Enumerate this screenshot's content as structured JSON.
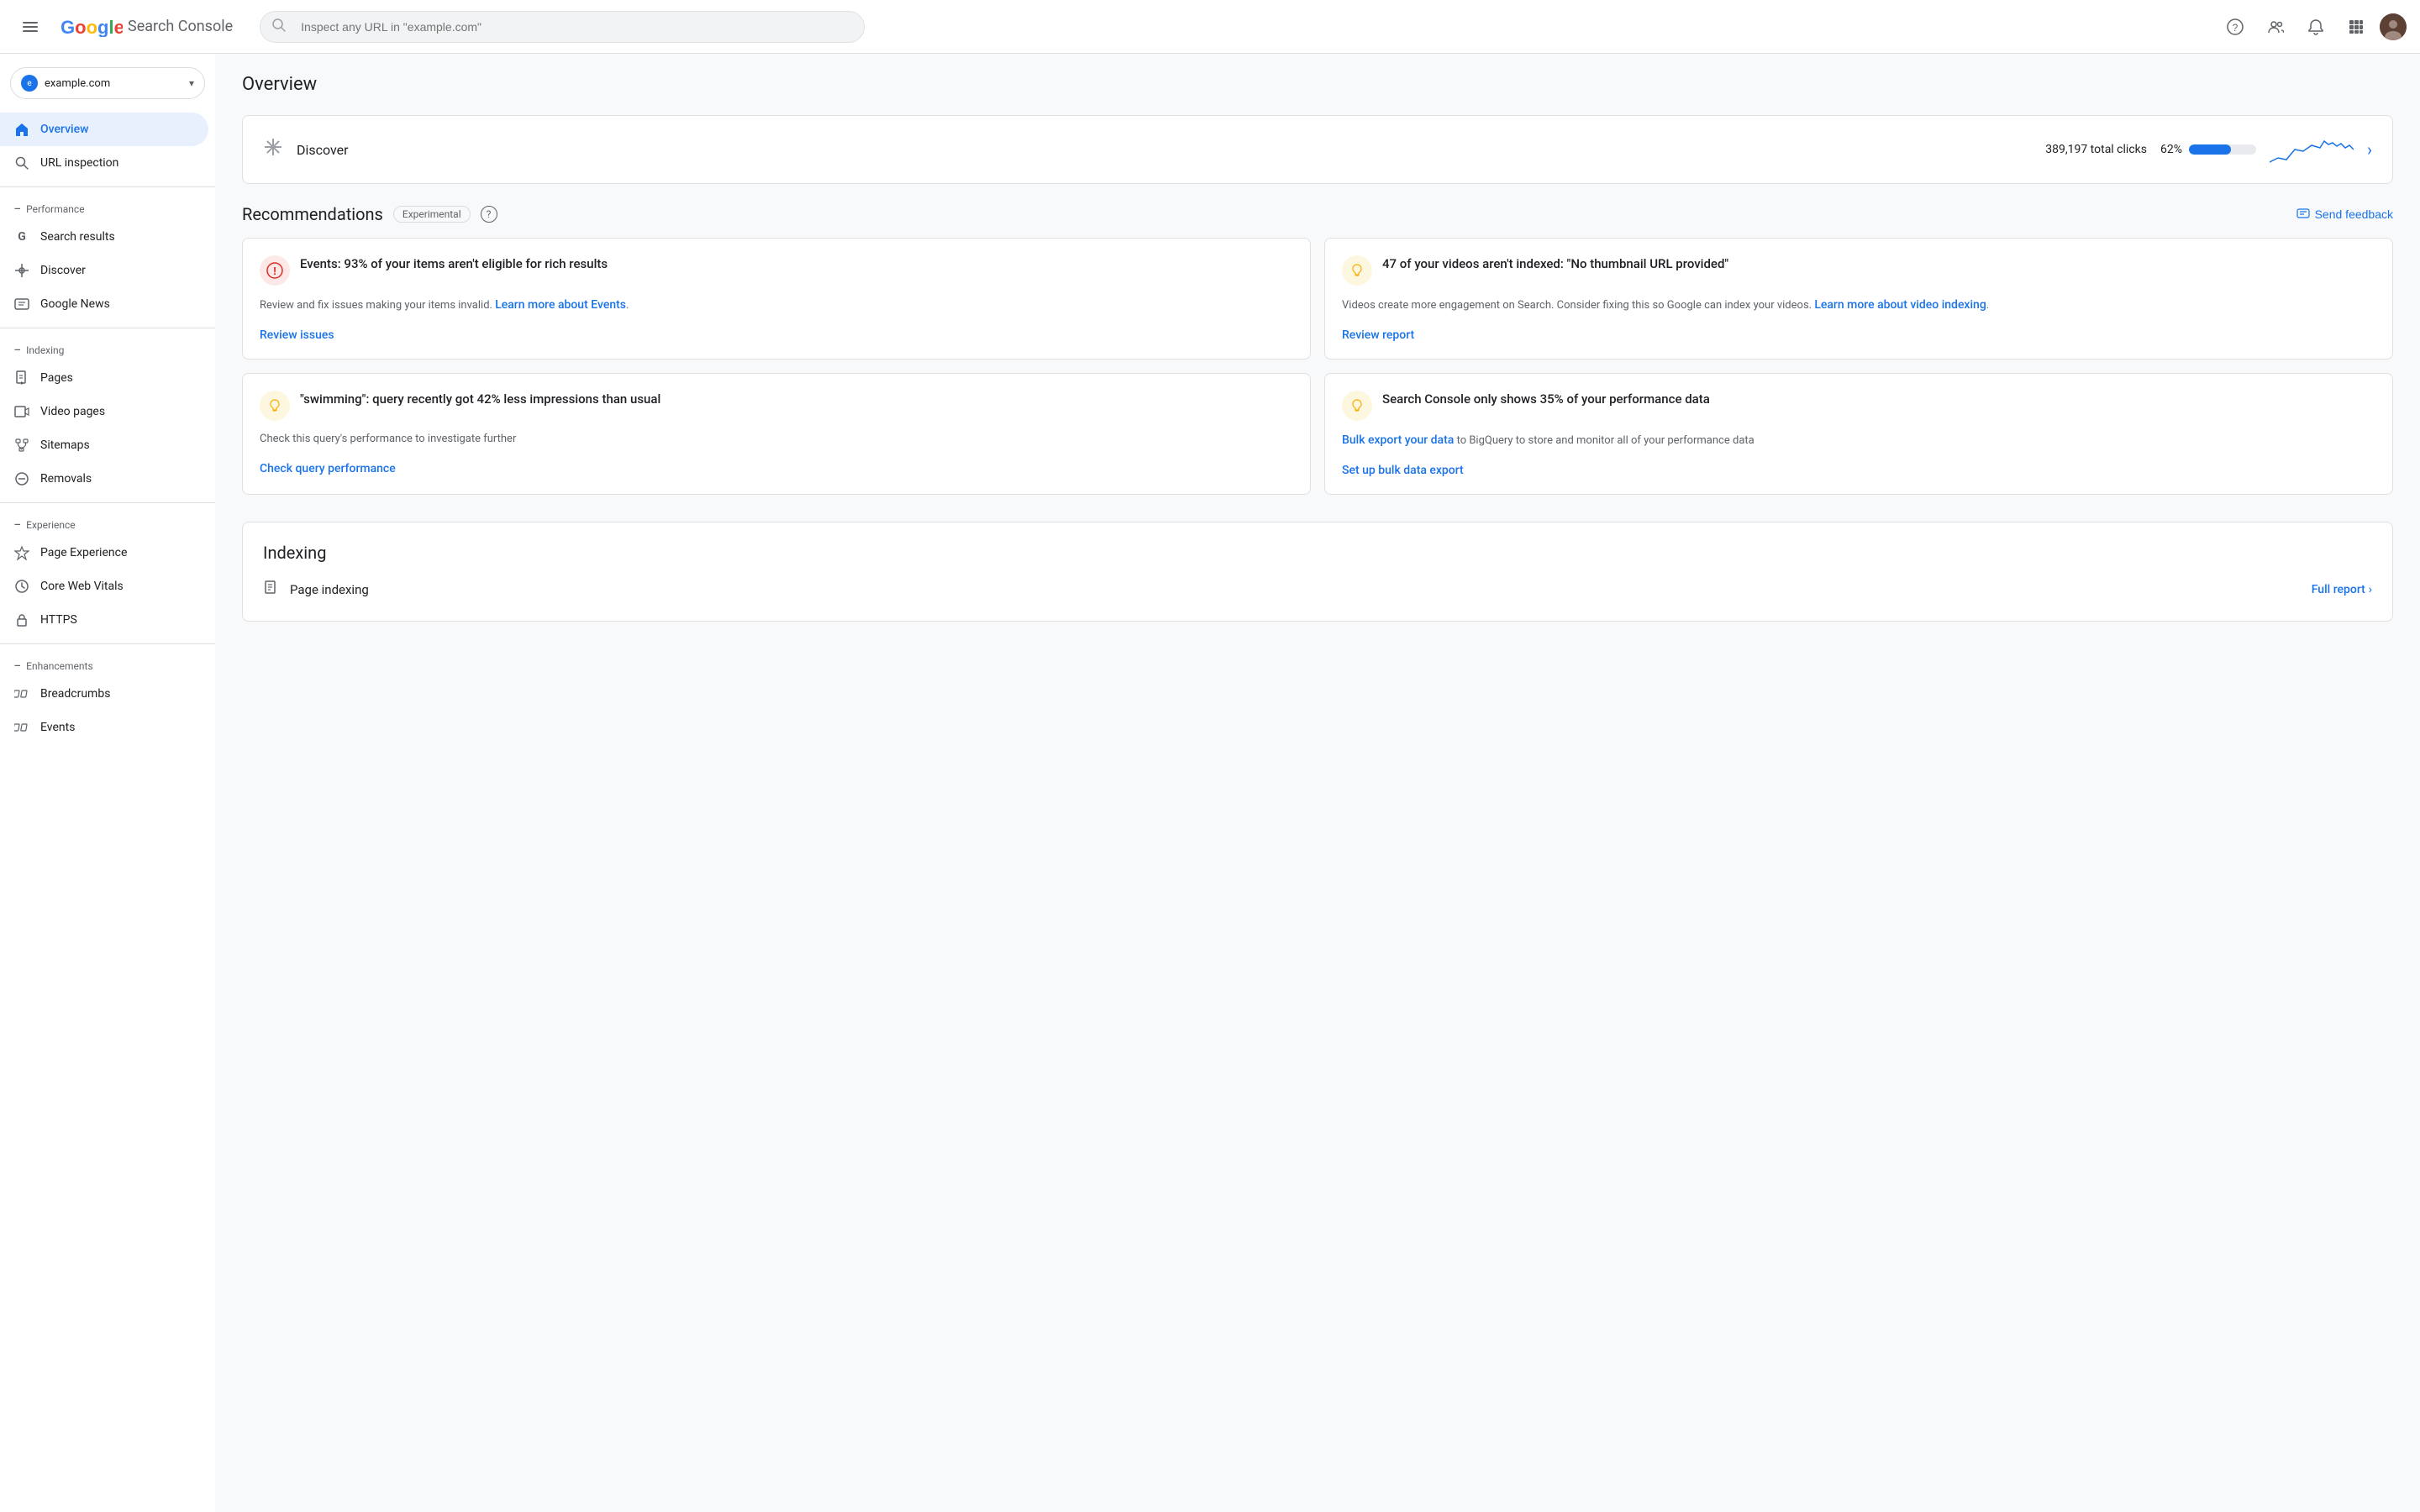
{
  "topbar": {
    "menu_label": "Menu",
    "logo_text": "Search Console",
    "search_placeholder": "Inspect any URL in \"example.com\"",
    "help_label": "Help",
    "manage_users_label": "Manage users",
    "notifications_label": "Notifications",
    "apps_label": "Google apps",
    "avatar_label": "Account"
  },
  "sidebar": {
    "property": {
      "name": "example.com",
      "chevron": "▾"
    },
    "nav": [
      {
        "id": "overview",
        "label": "Overview",
        "icon": "home",
        "active": true
      },
      {
        "id": "url-inspection",
        "label": "URL inspection",
        "icon": "search",
        "active": false
      }
    ],
    "sections": [
      {
        "id": "performance",
        "label": "Performance",
        "items": [
          {
            "id": "search-results",
            "label": "Search results",
            "icon": "G"
          },
          {
            "id": "discover",
            "label": "Discover",
            "icon": "✳"
          },
          {
            "id": "google-news",
            "label": "Google News",
            "icon": "📰"
          }
        ]
      },
      {
        "id": "indexing",
        "label": "Indexing",
        "items": [
          {
            "id": "pages",
            "label": "Pages",
            "icon": "📄"
          },
          {
            "id": "video-pages",
            "label": "Video pages",
            "icon": "📋"
          },
          {
            "id": "sitemaps",
            "label": "Sitemaps",
            "icon": "🗂"
          },
          {
            "id": "removals",
            "label": "Removals",
            "icon": "🚫"
          }
        ]
      },
      {
        "id": "experience",
        "label": "Experience",
        "items": [
          {
            "id": "page-experience",
            "label": "Page Experience",
            "icon": "⭐"
          },
          {
            "id": "core-web-vitals",
            "label": "Core Web Vitals",
            "icon": "⏱"
          },
          {
            "id": "https",
            "label": "HTTPS",
            "icon": "🔒"
          }
        ]
      },
      {
        "id": "enhancements",
        "label": "Enhancements",
        "items": [
          {
            "id": "breadcrumbs",
            "label": "Breadcrumbs",
            "icon": "◇"
          },
          {
            "id": "events",
            "label": "Events",
            "icon": "◇"
          }
        ]
      }
    ]
  },
  "main": {
    "page_title": "Overview",
    "discover": {
      "label": "Discover",
      "clicks": "389,197 total clicks",
      "pct": "62%",
      "bar_fill_width": 62
    },
    "recommendations": {
      "title": "Recommendations",
      "badge": "Experimental",
      "send_feedback": "Send feedback",
      "cards": [
        {
          "id": "events-card",
          "icon_type": "error",
          "title": "Events: 93% of your items aren't eligible for rich results",
          "body": "Review and fix issues making your items invalid.",
          "link_text_inline": "Learn more about Events",
          "link_text_inline_href": "#",
          "action_label": "Review issues",
          "action_href": "#"
        },
        {
          "id": "video-card",
          "icon_type": "info",
          "title": "47 of your videos aren't indexed: \"No thumbnail URL provided\"",
          "body": "Videos create more engagement on Search. Consider fixing this so Google can index your videos.",
          "link_text_inline": "Learn more about video indexing",
          "link_text_inline_href": "#",
          "action_label": "Review report",
          "action_href": "#"
        },
        {
          "id": "swimming-card",
          "icon_type": "info",
          "title": "\"swimming\": query recently got 42% less impressions than usual",
          "body": "Check this query's performance to investigate further",
          "link_text_inline": null,
          "action_label": "Check query performance",
          "action_href": "#"
        },
        {
          "id": "bulk-export-card",
          "icon_type": "info",
          "title": "Search Console only shows 35% of your performance data",
          "body": "to BigQuery to store and monitor all of your performance data",
          "body_link": "Bulk export your data",
          "link_text_inline": null,
          "action_label": "Set up bulk data export",
          "action_href": "#"
        }
      ]
    },
    "indexing": {
      "title": "Indexing",
      "page_indexing_label": "Page indexing",
      "full_report_label": "Full report"
    }
  },
  "icons": {
    "menu": "☰",
    "search": "🔍",
    "help": "?",
    "bell": "🔔",
    "grid": "⋮⋮",
    "chevron_right": "›",
    "home": "⌂",
    "collapse": "−",
    "error_circle": "!",
    "bulb": "💡"
  },
  "colors": {
    "accent": "#1a73e8",
    "error": "#d93025",
    "warning": "#f9ab00",
    "sidebar_active_bg": "#e8f0fe",
    "sidebar_active_text": "#1a73e8"
  }
}
